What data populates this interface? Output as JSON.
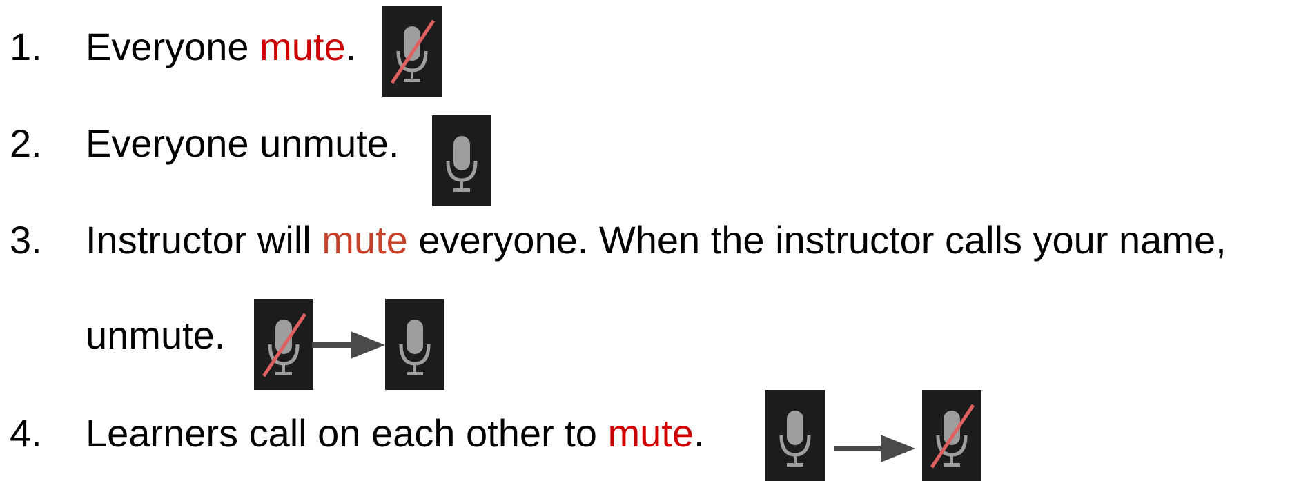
{
  "items": [
    {
      "number": "1.",
      "text_before": "Everyone ",
      "highlight": "mute",
      "text_after": ".",
      "icons": [
        "mic-muted-icon"
      ]
    },
    {
      "number": "2.",
      "text": "Everyone unmute.",
      "icons": [
        "mic-icon"
      ]
    },
    {
      "number": "3.",
      "text_before": "Instructor will ",
      "highlight": "mute",
      "text_after": " everyone. When the instructor calls your name,",
      "continuation": "unmute.",
      "icons": [
        "mic-muted-icon",
        "arrow-right-icon",
        "mic-icon"
      ]
    },
    {
      "number": "4.",
      "text_before": "Learners call on each other to ",
      "highlight": "mute",
      "text_after": ".",
      "icons": [
        "mic-icon",
        "arrow-right-icon",
        "mic-muted-icon"
      ]
    }
  ],
  "colors": {
    "highlight_red": "#cc0000",
    "highlight_orange": "#c6432b",
    "icon_background": "#1c1c1c",
    "mic_gray": "#9e9e9e",
    "slash_red": "#e06060",
    "arrow_gray": "#4a4a4a"
  }
}
